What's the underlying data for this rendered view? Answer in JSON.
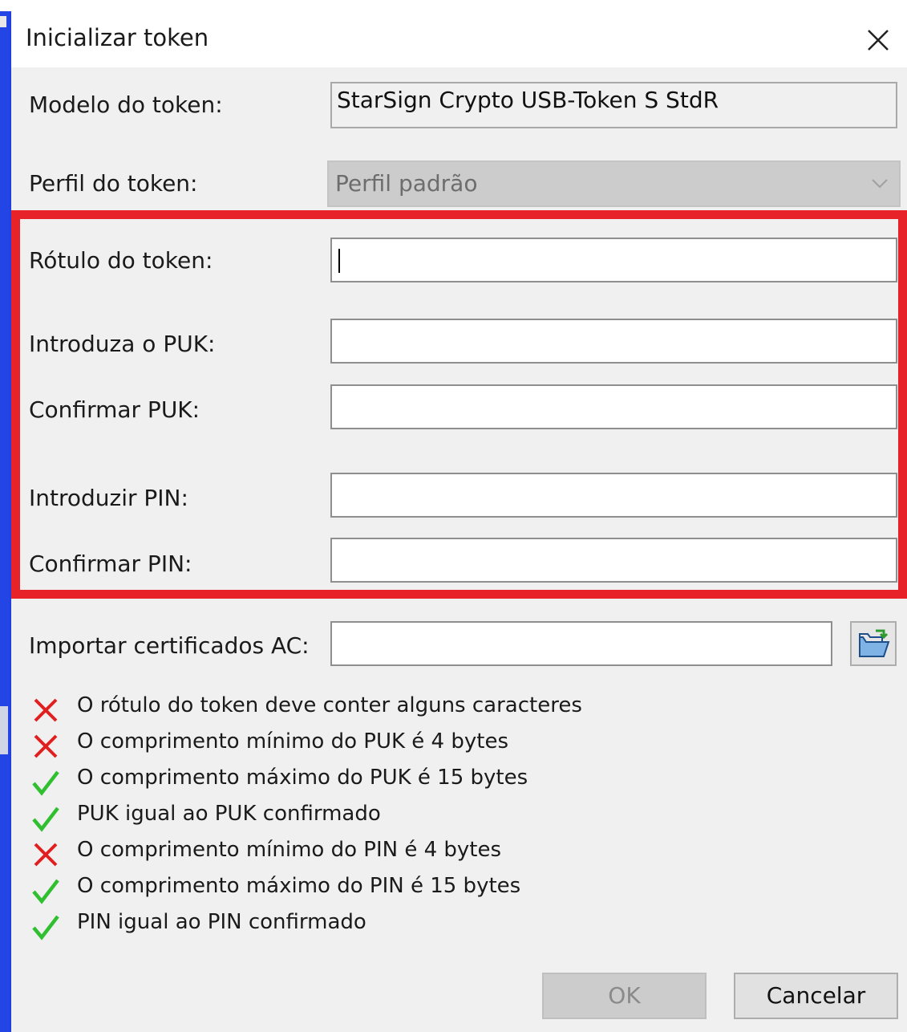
{
  "dialog": {
    "title": "Inicializar token"
  },
  "form": {
    "model_label": "Modelo do token:",
    "model_value": "StarSign Crypto USB-Token S StdR",
    "profile_label": "Perfil do token:",
    "profile_value": "Perfil padrão",
    "label_label": "Rótulo do token:",
    "label_value": "",
    "puk_label": "Introduza o PUK:",
    "puk_value": "",
    "puk_confirm_label": "Confirmar PUK:",
    "puk_confirm_value": "",
    "pin_label": "Introduzir PIN:",
    "pin_value": "",
    "pin_confirm_label": "Confirmar PIN:",
    "pin_confirm_value": "",
    "ca_label": "Importar certificados AC:",
    "ca_value": ""
  },
  "checks": [
    {
      "status": "fail",
      "icon": "red-x-icon",
      "text": "O rótulo do token deve conter alguns caracteres"
    },
    {
      "status": "fail",
      "icon": "red-x-icon",
      "text": "O comprimento mínimo do PUK é 4 bytes"
    },
    {
      "status": "pass",
      "icon": "green-check-icon",
      "text": "O comprimento máximo do PUK é 15 bytes"
    },
    {
      "status": "pass",
      "icon": "green-check-icon",
      "text": "PUK igual ao PUK confirmado"
    },
    {
      "status": "fail",
      "icon": "red-x-icon",
      "text": "O comprimento mínimo do PIN é 4 bytes"
    },
    {
      "status": "pass",
      "icon": "green-check-icon",
      "text": "O comprimento máximo do PIN é 15 bytes"
    },
    {
      "status": "pass",
      "icon": "green-check-icon",
      "text": "PIN igual ao PIN confirmado"
    }
  ],
  "buttons": {
    "ok": "OK",
    "cancel": "Cancelar"
  },
  "colors": {
    "highlight": "#e82229",
    "background": "#1f3fe0",
    "fail": "#e02020",
    "pass": "#2fbf2f"
  }
}
